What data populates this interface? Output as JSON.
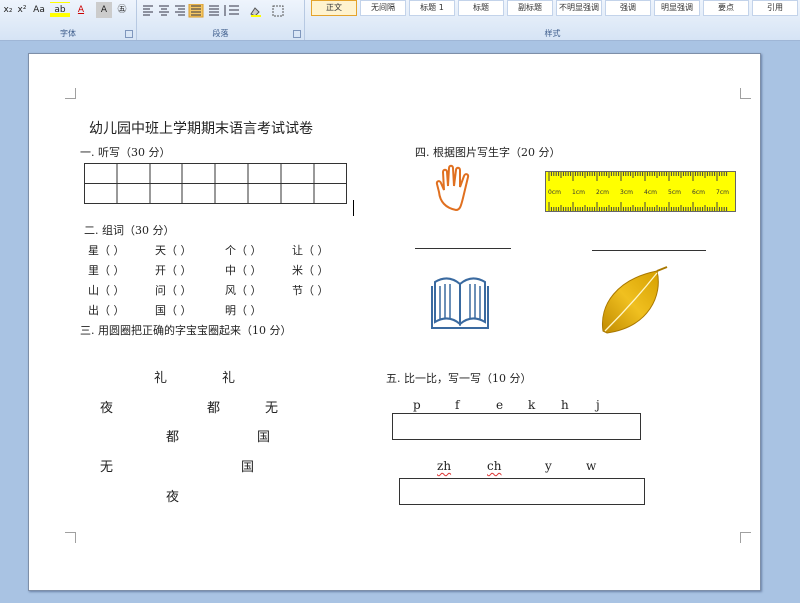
{
  "ribbon": {
    "font_group_label": "字体",
    "paragraph_group_label": "段落",
    "styles_group_label": "样式",
    "font_buttons": [
      "x₂",
      "x²",
      "Aa",
      "ab",
      "A",
      "A",
      "㊄"
    ],
    "styles": [
      "正文",
      "无间隔",
      "标题 1",
      "标题",
      "副标题",
      "不明显强调",
      "强调",
      "明显强调",
      "要点",
      "引用"
    ],
    "active_style_index": 0
  },
  "document": {
    "title": "幼儿园中班上学期期末语言考试试卷",
    "section1": {
      "label": "一. 听写（30 分）",
      "grid_columns": 8,
      "grid_rows": 2
    },
    "section2": {
      "label": "二. 组词（30 分）",
      "rows": [
        [
          "星（      ）",
          "天（      ）",
          "个（      ）",
          "让（      ）"
        ],
        [
          "里（      ）",
          "开（      ）",
          "中（      ）",
          "米（      ）"
        ],
        [
          "山（      ）",
          "问（      ）",
          "风（      ）",
          "节（      ）"
        ],
        [
          "出（      ）",
          "国（      ）",
          "明（      ）"
        ]
      ]
    },
    "section3": {
      "label": "三. 用圆圈把正确的字宝宝圈起来（10 分）",
      "characters": [
        "礼",
        "礼",
        "夜",
        "都",
        "无",
        "都",
        "国",
        "无",
        "国",
        "夜"
      ]
    },
    "section4": {
      "label": "四. 根据图片写生字（20 分）",
      "pictures": [
        "hand-picture",
        "ruler-picture",
        "book-picture",
        "leaf-picture"
      ],
      "ruler_ticks": [
        "0cm",
        "1cm",
        "2cm",
        "3cm",
        "4cm",
        "5cm",
        "6cm",
        "7cm"
      ]
    },
    "section5": {
      "label": "五. 比一比，写一写（10 分）",
      "row1": [
        "p",
        "f",
        "e",
        "k",
        "h",
        "j"
      ],
      "row2": [
        "zh",
        "ch",
        "y",
        "w"
      ]
    }
  },
  "colors": {
    "ruler_yellow": "#ffff00",
    "leaf_gold": "#e0b000",
    "hand_orange": "#e07020",
    "book_blue": "#3a6aa0"
  }
}
